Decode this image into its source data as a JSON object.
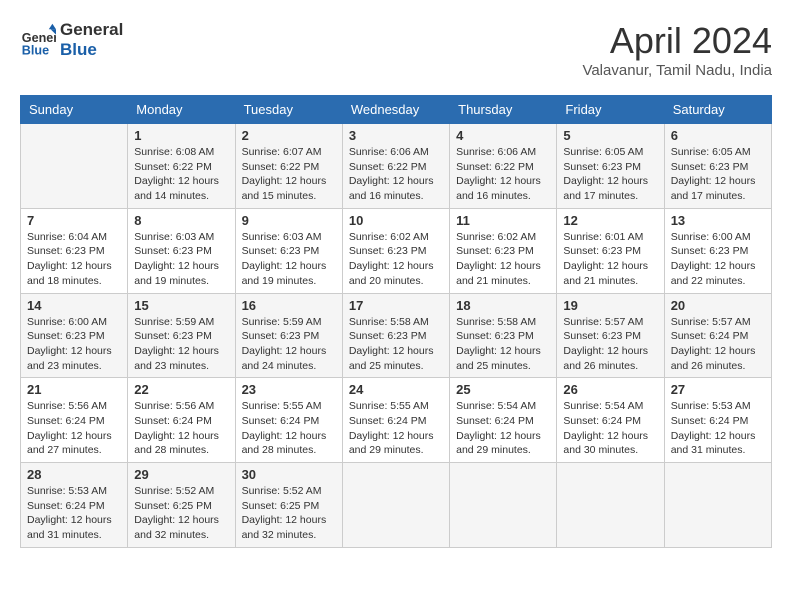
{
  "header": {
    "logo_line1": "General",
    "logo_line2": "Blue",
    "month_title": "April 2024",
    "location": "Valavanur, Tamil Nadu, India"
  },
  "days_of_week": [
    "Sunday",
    "Monday",
    "Tuesday",
    "Wednesday",
    "Thursday",
    "Friday",
    "Saturday"
  ],
  "weeks": [
    [
      {
        "day": "",
        "info": ""
      },
      {
        "day": "1",
        "info": "Sunrise: 6:08 AM\nSunset: 6:22 PM\nDaylight: 12 hours\nand 14 minutes."
      },
      {
        "day": "2",
        "info": "Sunrise: 6:07 AM\nSunset: 6:22 PM\nDaylight: 12 hours\nand 15 minutes."
      },
      {
        "day": "3",
        "info": "Sunrise: 6:06 AM\nSunset: 6:22 PM\nDaylight: 12 hours\nand 16 minutes."
      },
      {
        "day": "4",
        "info": "Sunrise: 6:06 AM\nSunset: 6:22 PM\nDaylight: 12 hours\nand 16 minutes."
      },
      {
        "day": "5",
        "info": "Sunrise: 6:05 AM\nSunset: 6:23 PM\nDaylight: 12 hours\nand 17 minutes."
      },
      {
        "day": "6",
        "info": "Sunrise: 6:05 AM\nSunset: 6:23 PM\nDaylight: 12 hours\nand 17 minutes."
      }
    ],
    [
      {
        "day": "7",
        "info": "Sunrise: 6:04 AM\nSunset: 6:23 PM\nDaylight: 12 hours\nand 18 minutes."
      },
      {
        "day": "8",
        "info": "Sunrise: 6:03 AM\nSunset: 6:23 PM\nDaylight: 12 hours\nand 19 minutes."
      },
      {
        "day": "9",
        "info": "Sunrise: 6:03 AM\nSunset: 6:23 PM\nDaylight: 12 hours\nand 19 minutes."
      },
      {
        "day": "10",
        "info": "Sunrise: 6:02 AM\nSunset: 6:23 PM\nDaylight: 12 hours\nand 20 minutes."
      },
      {
        "day": "11",
        "info": "Sunrise: 6:02 AM\nSunset: 6:23 PM\nDaylight: 12 hours\nand 21 minutes."
      },
      {
        "day": "12",
        "info": "Sunrise: 6:01 AM\nSunset: 6:23 PM\nDaylight: 12 hours\nand 21 minutes."
      },
      {
        "day": "13",
        "info": "Sunrise: 6:00 AM\nSunset: 6:23 PM\nDaylight: 12 hours\nand 22 minutes."
      }
    ],
    [
      {
        "day": "14",
        "info": "Sunrise: 6:00 AM\nSunset: 6:23 PM\nDaylight: 12 hours\nand 23 minutes."
      },
      {
        "day": "15",
        "info": "Sunrise: 5:59 AM\nSunset: 6:23 PM\nDaylight: 12 hours\nand 23 minutes."
      },
      {
        "day": "16",
        "info": "Sunrise: 5:59 AM\nSunset: 6:23 PM\nDaylight: 12 hours\nand 24 minutes."
      },
      {
        "day": "17",
        "info": "Sunrise: 5:58 AM\nSunset: 6:23 PM\nDaylight: 12 hours\nand 25 minutes."
      },
      {
        "day": "18",
        "info": "Sunrise: 5:58 AM\nSunset: 6:23 PM\nDaylight: 12 hours\nand 25 minutes."
      },
      {
        "day": "19",
        "info": "Sunrise: 5:57 AM\nSunset: 6:23 PM\nDaylight: 12 hours\nand 26 minutes."
      },
      {
        "day": "20",
        "info": "Sunrise: 5:57 AM\nSunset: 6:24 PM\nDaylight: 12 hours\nand 26 minutes."
      }
    ],
    [
      {
        "day": "21",
        "info": "Sunrise: 5:56 AM\nSunset: 6:24 PM\nDaylight: 12 hours\nand 27 minutes."
      },
      {
        "day": "22",
        "info": "Sunrise: 5:56 AM\nSunset: 6:24 PM\nDaylight: 12 hours\nand 28 minutes."
      },
      {
        "day": "23",
        "info": "Sunrise: 5:55 AM\nSunset: 6:24 PM\nDaylight: 12 hours\nand 28 minutes."
      },
      {
        "day": "24",
        "info": "Sunrise: 5:55 AM\nSunset: 6:24 PM\nDaylight: 12 hours\nand 29 minutes."
      },
      {
        "day": "25",
        "info": "Sunrise: 5:54 AM\nSunset: 6:24 PM\nDaylight: 12 hours\nand 29 minutes."
      },
      {
        "day": "26",
        "info": "Sunrise: 5:54 AM\nSunset: 6:24 PM\nDaylight: 12 hours\nand 30 minutes."
      },
      {
        "day": "27",
        "info": "Sunrise: 5:53 AM\nSunset: 6:24 PM\nDaylight: 12 hours\nand 31 minutes."
      }
    ],
    [
      {
        "day": "28",
        "info": "Sunrise: 5:53 AM\nSunset: 6:24 PM\nDaylight: 12 hours\nand 31 minutes."
      },
      {
        "day": "29",
        "info": "Sunrise: 5:52 AM\nSunset: 6:25 PM\nDaylight: 12 hours\nand 32 minutes."
      },
      {
        "day": "30",
        "info": "Sunrise: 5:52 AM\nSunset: 6:25 PM\nDaylight: 12 hours\nand 32 minutes."
      },
      {
        "day": "",
        "info": ""
      },
      {
        "day": "",
        "info": ""
      },
      {
        "day": "",
        "info": ""
      },
      {
        "day": "",
        "info": ""
      }
    ]
  ]
}
